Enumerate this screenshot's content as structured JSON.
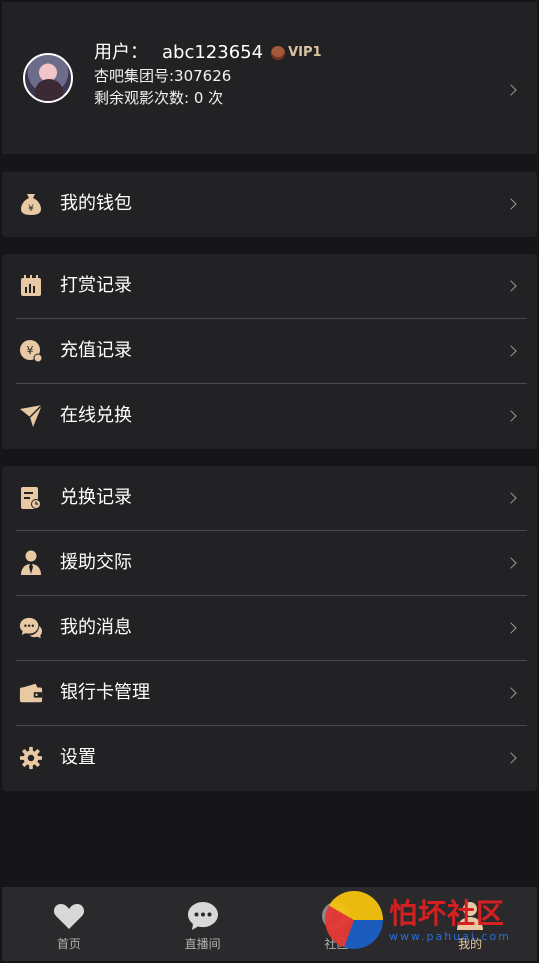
{
  "profile": {
    "user_label": "用户：",
    "username": "abc123654",
    "vip_badge": "VIP1",
    "group_label": "杏吧集团号:307626",
    "views_label": "剩余观影次数: 0 次"
  },
  "menu_groups": [
    {
      "items": [
        {
          "label": "我的钱包",
          "icon": "money-bag-icon"
        }
      ]
    },
    {
      "items": [
        {
          "label": "打赏记录",
          "icon": "reward-record-icon"
        },
        {
          "label": "充值记录",
          "icon": "recharge-icon"
        },
        {
          "label": "在线兑换",
          "icon": "paper-plane-icon"
        }
      ]
    },
    {
      "items": [
        {
          "label": "兑换记录",
          "icon": "exchange-record-icon"
        },
        {
          "label": "援助交际",
          "icon": "person-tie-icon"
        },
        {
          "label": "我的消息",
          "icon": "chat-bubbles-icon"
        },
        {
          "label": "银行卡管理",
          "icon": "wallet-icon"
        },
        {
          "label": "设置",
          "icon": "gear-icon"
        }
      ]
    }
  ],
  "tabbar": {
    "tabs": [
      {
        "label": "首页",
        "icon": "heart-icon"
      },
      {
        "label": "直播间",
        "icon": "chat-icon"
      },
      {
        "label": "社区",
        "icon": "community-icon"
      },
      {
        "label": "我的",
        "icon": "person-icon"
      }
    ],
    "active_index": 3
  },
  "watermark": {
    "main": "怕坏社区",
    "sub": "www.pahuai.com"
  },
  "colors": {
    "accent": "#e8c9a4",
    "background": "#161618",
    "card": "#222224"
  }
}
